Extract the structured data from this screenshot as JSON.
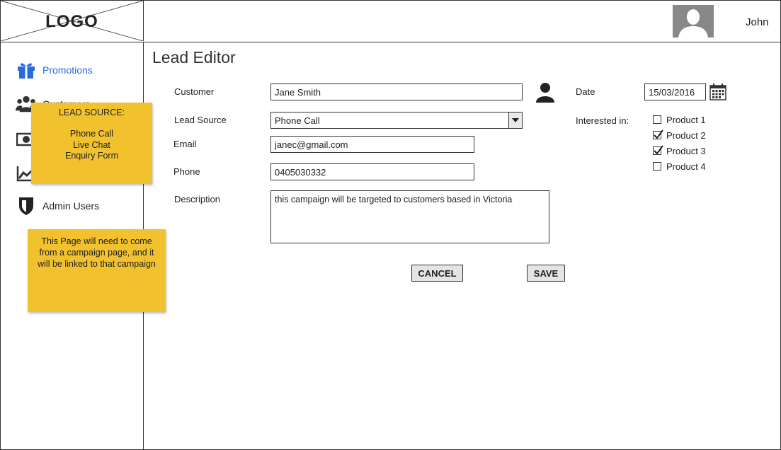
{
  "header": {
    "logo_text": "LOGO",
    "user_name": "John"
  },
  "sidebar": {
    "items": [
      {
        "label": "Promotions",
        "icon": "gift-icon",
        "active": true
      },
      {
        "label": "Customers",
        "icon": "users-icon"
      },
      {
        "label": "",
        "icon": "money-icon"
      },
      {
        "label": "",
        "icon": "chart-icon"
      },
      {
        "label": "Admin Users",
        "icon": "shield-icon"
      }
    ]
  },
  "page": {
    "title": "Lead Editor"
  },
  "form": {
    "customer_label": "Customer",
    "customer_value": "Jane Smith",
    "lead_source_label": "Lead Source",
    "lead_source_value": "Phone Call",
    "email_label": "Email",
    "email_value": "janec@gmail.com",
    "phone_label": "Phone",
    "phone_value": "0405030332",
    "description_label": "Description",
    "description_value": "this campaign will be targeted to customers based in Victoria",
    "date_label": "Date",
    "date_value": "15/03/2016",
    "interested_label": "Interested in:",
    "products": [
      {
        "label": "Product 1",
        "checked": false
      },
      {
        "label": "Product 2",
        "checked": true
      },
      {
        "label": "Product 3",
        "checked": true
      },
      {
        "label": "Product 4",
        "checked": false
      }
    ],
    "cancel_label": "CANCEL",
    "save_label": "SAVE"
  },
  "notes": {
    "lead_source_heading": "LEAD SOURCE:",
    "lead_source_options": [
      "Phone Call",
      "Live Chat",
      "Enquiry Form"
    ],
    "campaign_note": "This Page will need to come from a campaign page, and it will be linked to that campaign"
  },
  "colors": {
    "accent": "#2a6ae0",
    "sticky": "#f2c12e",
    "avatar_bg": "#888888"
  }
}
